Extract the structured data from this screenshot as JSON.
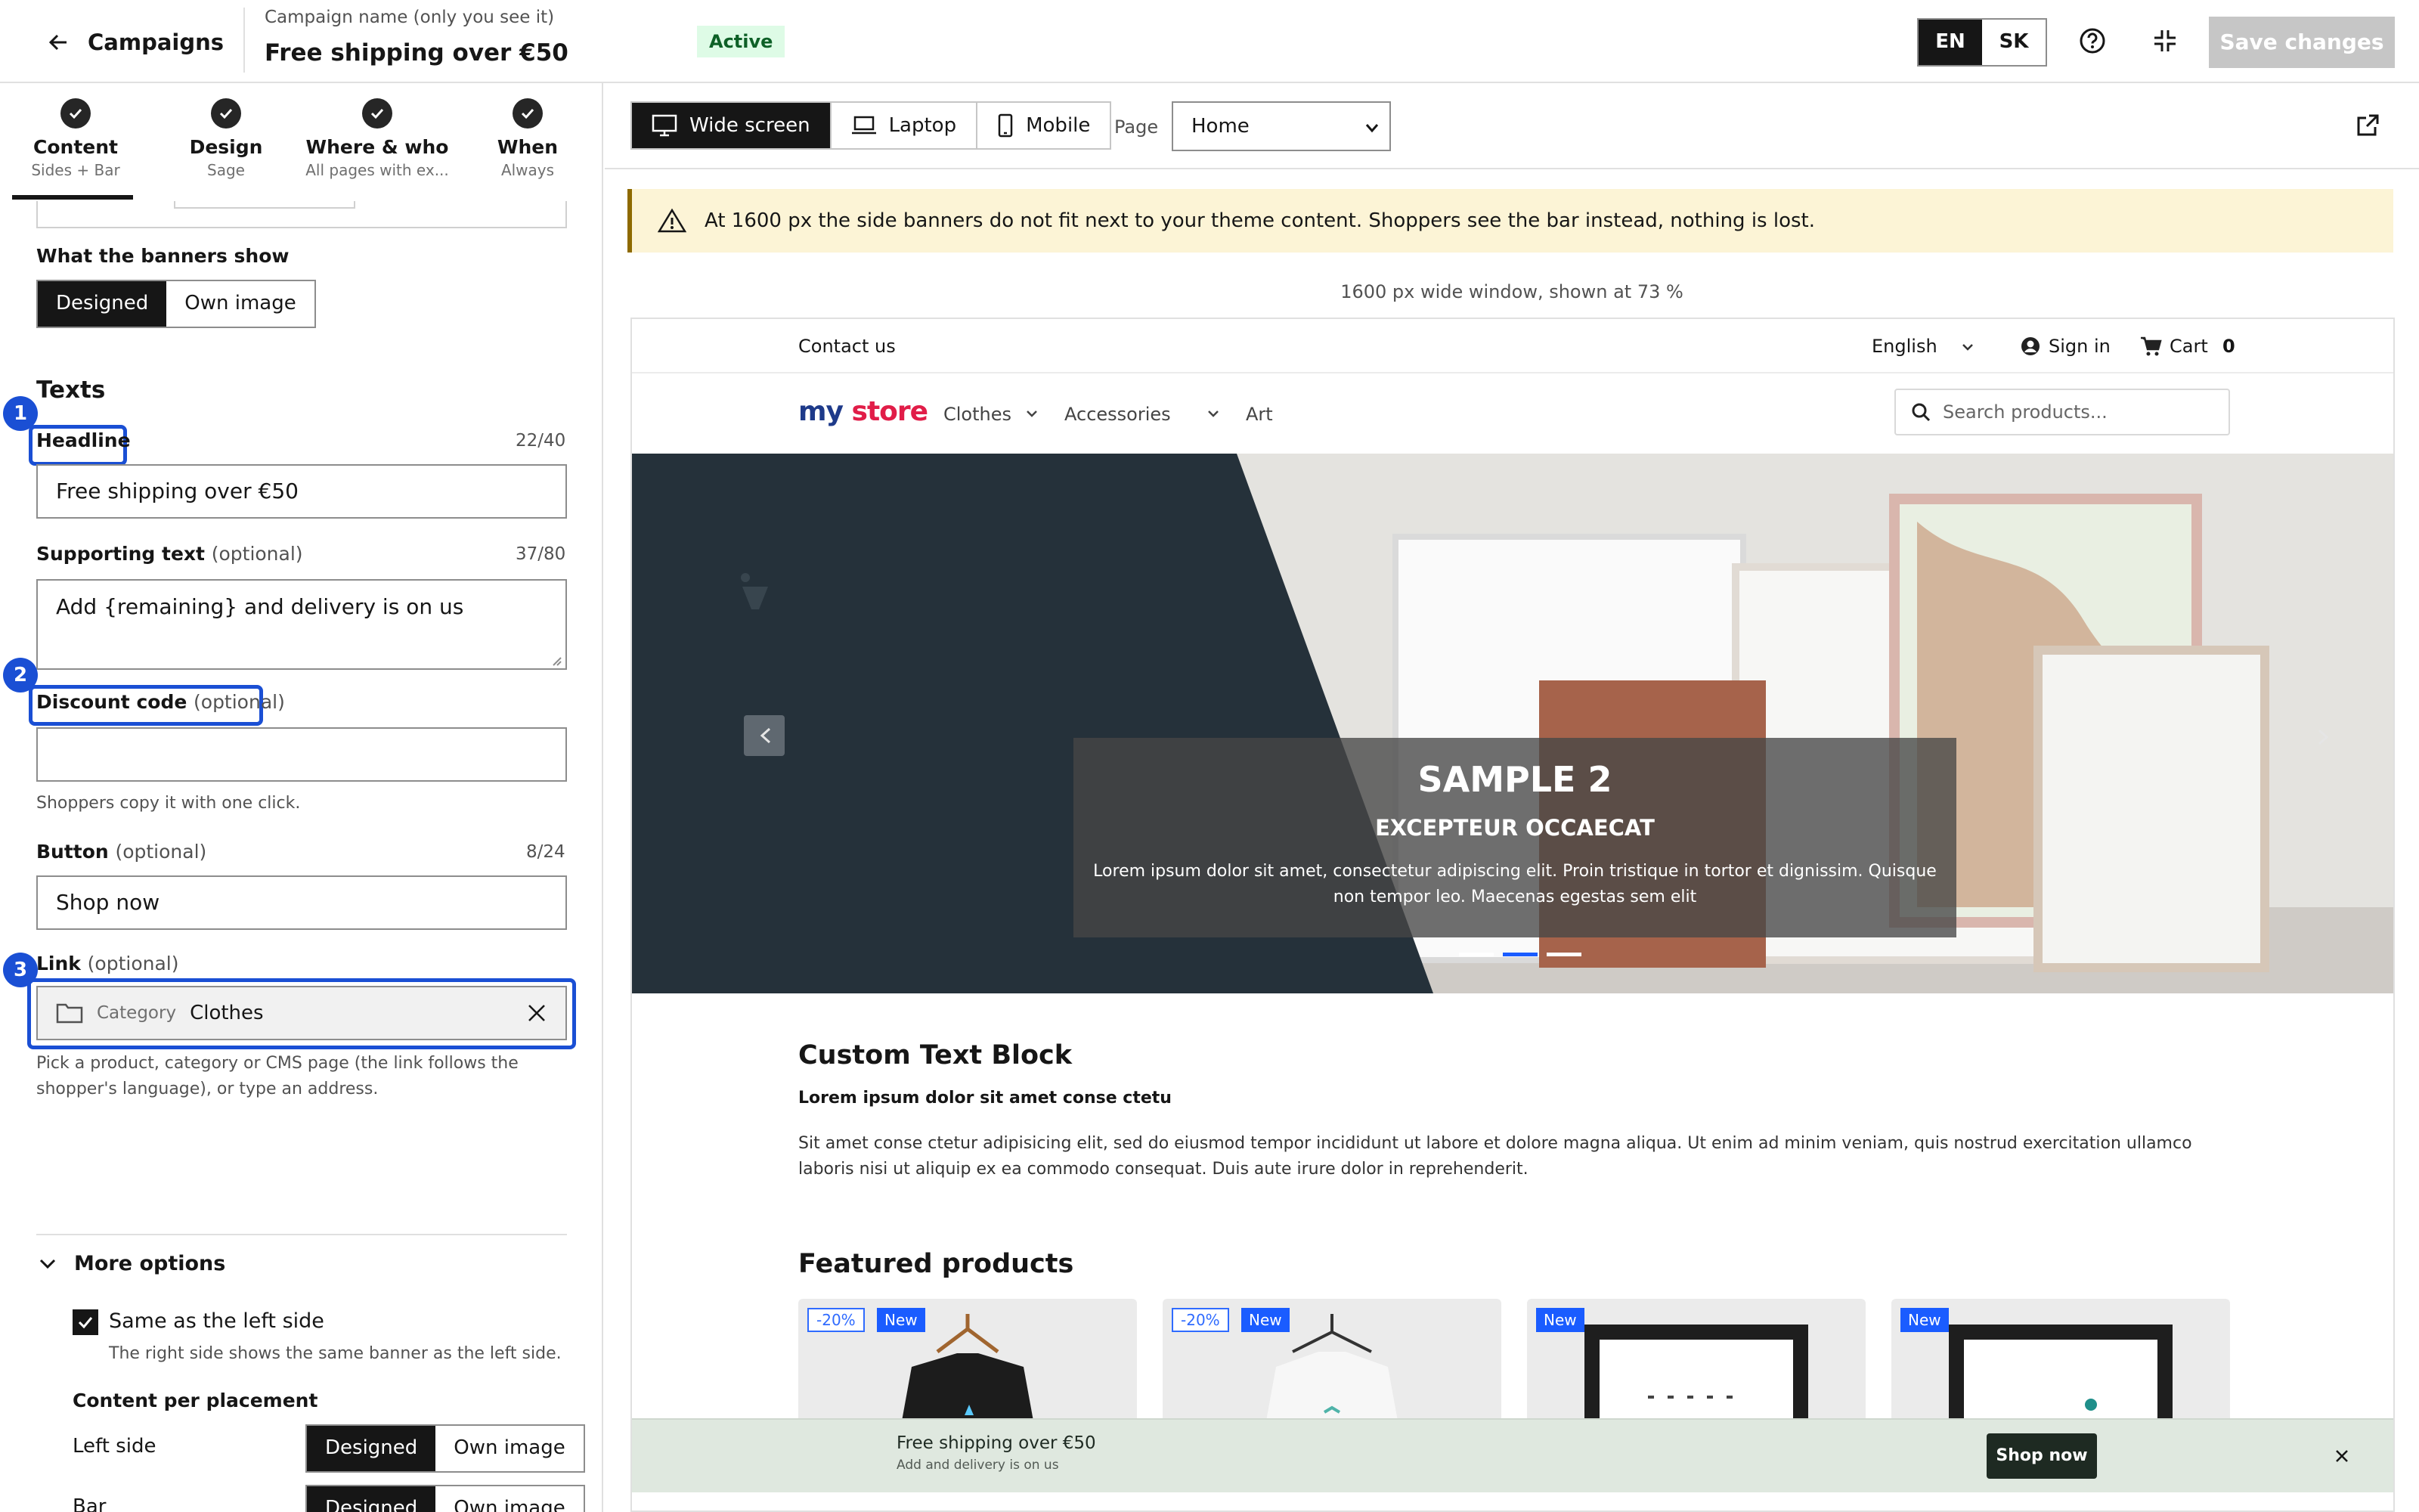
{
  "topbar": {
    "back_label": "Campaigns",
    "campaign_label": "Campaign name (only you see it)",
    "campaign_name": "Free shipping over €50",
    "status": "Active",
    "lang_en": "EN",
    "lang_sk": "SK",
    "save_label": "Save changes"
  },
  "steps": [
    {
      "title": "Content",
      "sub": "Sides + Bar"
    },
    {
      "title": "Design",
      "sub": "Sage"
    },
    {
      "title": "Where & who",
      "sub": "All pages with ex..."
    },
    {
      "title": "When",
      "sub": "Always"
    }
  ],
  "form": {
    "banners_label": "What the banners show",
    "banners_designed": "Designed",
    "banners_own": "Own image",
    "texts_heading": "Texts",
    "headline_label": "Headline",
    "headline_count": "22/40",
    "headline_value": "Free shipping over €50",
    "supporting_label": "Supporting text",
    "optional": "(optional)",
    "supporting_count": "37/80",
    "supporting_value": "Add {remaining} and delivery is on us",
    "discount_label": "Discount code",
    "discount_value": "",
    "discount_helper": "Shoppers copy it with one click.",
    "button_label": "Button",
    "button_count": "8/24",
    "button_value": "Shop now",
    "link_label": "Link",
    "link_type": "Category",
    "link_value": "Clothes",
    "link_helper_1": "Pick a product, category or CMS page (the link follows the",
    "link_helper_2": "shopper's language), or type an address.",
    "more_options": "More options",
    "same_side_label": "Same as the left side",
    "same_side_helper": "The right side shows the same banner as the left side.",
    "same_side_checked": true,
    "placement_heading": "Content per placement",
    "left_side": "Left side",
    "bar": "Bar",
    "designed": "Designed",
    "own_image": "Own image"
  },
  "annotations": [
    "1",
    "2",
    "3"
  ],
  "preview": {
    "devices": [
      "Wide screen",
      "Laptop",
      "Mobile"
    ],
    "page_label": "Page",
    "page_value": "Home",
    "warning": "At 1600 px the side banners do not fit next to your theme content. Shoppers see the bar instead, nothing is lost.",
    "scale_note": "1600 px wide window, shown at 73 %"
  },
  "store": {
    "contact": "Contact us",
    "language": "English",
    "sign_in": "Sign in",
    "cart": "Cart",
    "cart_count": "0",
    "logo_my": "my",
    "logo_store": "store",
    "nav": [
      "Clothes",
      "Accessories",
      "Art"
    ],
    "search_placeholder": "Search products...",
    "slide_title": "SAMPLE 2",
    "slide_subtitle": "EXCEPTEUR OCCAECAT",
    "slide_text_1": "Lorem ipsum dolor sit amet, consectetur adipiscing elit. Proin tristique in tortor et dignissim. Quisque",
    "slide_text_2": "non tempor leo. Maecenas egestas sem elit",
    "block_title": "Custom Text Block",
    "block_bold": "Lorem ipsum dolor sit amet conse ctetu",
    "block_text_1": "Sit amet conse ctetur adipisicing elit, sed do eiusmod tempor incididunt ut labore et dolore magna aliqua. Ut enim ad minim veniam, quis nostrud exercitation ullamco",
    "block_text_2": "laboris nisi ut aliquip ex ea commodo consequat. Duis aute irure dolor in reprehenderit.",
    "featured_title": "Featured products",
    "tag_discount": "-20%",
    "tag_new": "New",
    "bar_title": "Free shipping over €50",
    "bar_sub": "Add and delivery is on us",
    "bar_button": "Shop now"
  }
}
